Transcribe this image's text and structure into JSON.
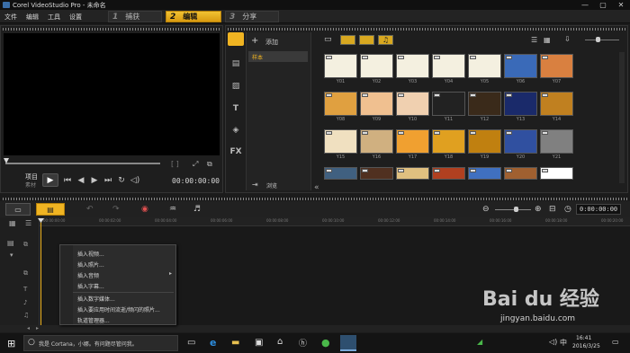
{
  "window": {
    "title": "Corel VideoStudio Pro - 未命名",
    "minimize": "—",
    "maximize": "▢",
    "close": "✕"
  },
  "menu": [
    "文件",
    "编辑",
    "工具",
    "设置"
  ],
  "steps": [
    {
      "num": "1",
      "label": "捕获"
    },
    {
      "num": "2",
      "label": "编辑"
    },
    {
      "num": "3",
      "label": "分享"
    }
  ],
  "player": {
    "project_label": "项目",
    "clip_label": "素材",
    "timecode": "00:00:00:00",
    "brackets": "[ ]"
  },
  "library": {
    "add_label": "添加",
    "folder_item": "样本",
    "browse_label": "浏览",
    "thumbs": [
      [
        "Y01",
        "Y02",
        "Y03",
        "Y04",
        "Y05",
        "Y06",
        "Y07"
      ],
      [
        "Y08",
        "Y09",
        "Y10",
        "Y11",
        "Y12",
        "Y13",
        "Y14"
      ],
      [
        "Y15",
        "Y16",
        "Y17",
        "Y18",
        "Y19",
        "Y20",
        "Y21"
      ],
      [
        "",
        "",
        "",
        "",
        "",
        "",
        ""
      ]
    ],
    "collapse_icon": "«"
  },
  "timeline": {
    "timecode": "0:00:00:00",
    "ruler": [
      "00:00:00:00",
      "00:00:02:00",
      "00:00:04:00",
      "00:00:06:00",
      "00:00:08:00",
      "00:00:10:00",
      "00:00:12:00",
      "00:00:14:00",
      "00:00:16:00",
      "00:00:18:00",
      "00:00:20:00"
    ]
  },
  "context_menu": [
    "插入视频...",
    "插入照片...",
    "插入音频",
    "插入字幕...",
    "插入数字媒体...",
    "插入要应用时间流逝/频闪的照片...",
    "轨道管理器..."
  ],
  "taskbar": {
    "search_placeholder": "我是 Cortana，小娜。有问题尽管问我。",
    "time": "16:41",
    "date": "2016/3/25"
  },
  "watermark": {
    "brand": "Bai du 经验",
    "url": "jingyan.baidu.com"
  },
  "colors": {
    "accent": "#f0b422",
    "bg": "#1b1b1b"
  }
}
